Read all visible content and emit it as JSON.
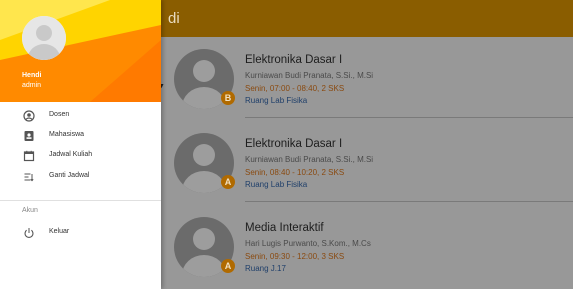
{
  "appbar": {
    "title": "di"
  },
  "drawer": {
    "user": {
      "name": "Hendi",
      "role": "admin"
    },
    "menu": [
      {
        "label": "Dosen",
        "icon": "account-circle-icon"
      },
      {
        "label": "Mahasiswa",
        "icon": "contact-card-icon"
      },
      {
        "label": "Jadwal Kuliah",
        "icon": "calendar-icon"
      },
      {
        "label": "Ganti Jadwal",
        "icon": "swap-schedule-icon"
      }
    ],
    "section_label": "Akun",
    "logout": {
      "label": "Keluar",
      "icon": "power-icon"
    }
  },
  "schedule": [
    {
      "course": "Elektronika Dasar I",
      "lecturer": "Kurniawan Budi Pranata, S.Si., M.Si",
      "time": "Senin, 07:00 - 08:40, 2 SKS",
      "room": "Ruang Lab Fisika",
      "class": "B"
    },
    {
      "course": "Elektronika Dasar I",
      "lecturer": "Kurniawan Budi Pranata, S.Si., M.Si",
      "time": "Senin, 08:40 - 10:20, 2 SKS",
      "room": "Ruang Lab Fisika",
      "class": "A"
    },
    {
      "course": "Media Interaktif",
      "lecturer": "Hari Lugis Purwanto, S.Kom., M.Cs",
      "time": "Senin, 09:30 - 12:00, 3 SKS",
      "room": "Ruang J.17",
      "class": "A"
    }
  ],
  "colors": {
    "primary": "#ff8a00",
    "appbar_dim": "#8a5d00",
    "scrim": "#989898"
  }
}
